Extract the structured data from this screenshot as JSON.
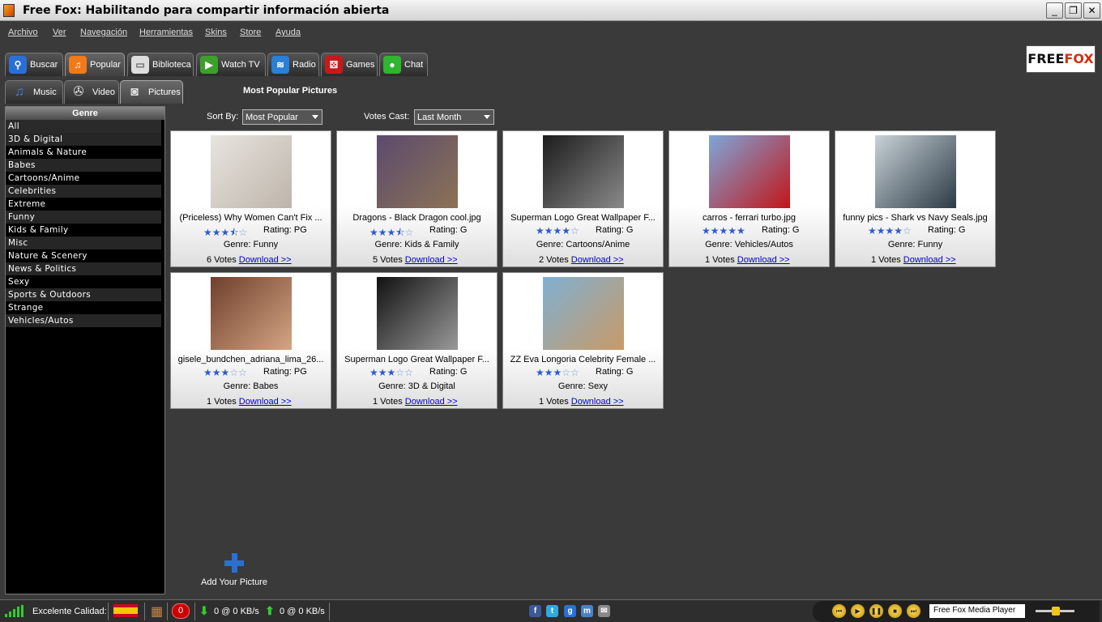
{
  "window": {
    "title": "Free Fox: Habilitando para compartir información abierta"
  },
  "menu": [
    "Archivo",
    "Ver",
    "Navegación",
    "Herramientas",
    "Skins",
    "Store",
    "Ayuda"
  ],
  "tabs": [
    {
      "label": "Buscar",
      "icon": "search-icon",
      "color": "#2a6fd6"
    },
    {
      "label": "Popular",
      "icon": "music-note-icon",
      "color": "#f07a1a"
    },
    {
      "label": "Biblioteca",
      "icon": "folder-icon",
      "color": "#dddddd"
    },
    {
      "label": "Watch TV",
      "icon": "play-icon",
      "color": "#3ca12a"
    },
    {
      "label": "Radio",
      "icon": "wifi-icon",
      "color": "#2a7fd6"
    },
    {
      "label": "Games",
      "icon": "dice-icon",
      "color": "#c8181b"
    },
    {
      "label": "Chat",
      "icon": "chat-bubble-icon",
      "color": "#2fb52f"
    }
  ],
  "logo": {
    "part1": "FREE",
    "part2": "FOX"
  },
  "subtabs": [
    {
      "label": "Music",
      "icon": "music-note-icon"
    },
    {
      "label": "Video",
      "icon": "film-reel-icon"
    },
    {
      "label": "Pictures",
      "icon": "camera-icon"
    }
  ],
  "section_title": "Most Popular Pictures",
  "sidebar": {
    "header": "Genre",
    "genres": [
      "All",
      "3D & Digital",
      "Animals & Nature",
      "Babes",
      "Cartoons/Anime",
      "Celebrities",
      "Extreme",
      "Funny",
      "Kids & Family",
      "Misc",
      "Nature & Scenery",
      "News & Politics",
      "Sexy",
      "Sports & Outdoors",
      "Strange",
      "Vehicles/Autos"
    ]
  },
  "controls": {
    "sort_label": "Sort By:",
    "sort_value": "Most Popular",
    "votes_label": "Votes Cast:",
    "votes_value": "Last Month"
  },
  "cards": [
    {
      "title": "(Priceless) Why Women Can't Fix ...",
      "stars": 3.5,
      "rating": "Rating: PG",
      "genre": "Genre: Funny",
      "votes": "6 Votes",
      "download": "Download >>",
      "thumb": [
        "#e8e4de",
        "#bdb5ab"
      ]
    },
    {
      "title": "Dragons - Black Dragon cool.jpg",
      "stars": 3.5,
      "rating": "Rating: G",
      "genre": "Genre: Kids & Family",
      "votes": "5 Votes",
      "download": "Download >>",
      "thumb": [
        "#5b4a6e",
        "#8c7355"
      ]
    },
    {
      "title": "Superman Logo Great Wallpaper F...",
      "stars": 4,
      "rating": "Rating: G",
      "genre": "Genre: Cartoons/Anime",
      "votes": "2 Votes",
      "download": "Download >>",
      "thumb": [
        "#1c1c1c",
        "#8a8a8a"
      ]
    },
    {
      "title": "carros - ferrari turbo.jpg",
      "stars": 5,
      "rating": "Rating: G",
      "genre": "Genre: Vehicles/Autos",
      "votes": "1 Votes",
      "download": "Download >>",
      "thumb": [
        "#7da6d9",
        "#c2161a"
      ]
    },
    {
      "title": "funny pics - Shark vs Navy Seals.jpg",
      "stars": 4,
      "rating": "Rating: G",
      "genre": "Genre: Funny",
      "votes": "1 Votes",
      "download": "Download >>",
      "thumb": [
        "#c9d2d8",
        "#2b3a45"
      ]
    },
    {
      "title": "gisele_bundchen_adriana_lima_26...",
      "stars": 3,
      "rating": "Rating: PG",
      "genre": "Genre: Babes",
      "votes": "1 Votes",
      "download": "Download >>",
      "thumb": [
        "#6e3f2b",
        "#d6a585"
      ]
    },
    {
      "title": "Superman Logo Great Wallpaper F...",
      "stars": 3,
      "rating": "Rating: G",
      "genre": "Genre: 3D & Digital",
      "votes": "1 Votes",
      "download": "Download >>",
      "thumb": [
        "#111111",
        "#9a9a9a"
      ]
    },
    {
      "title": "ZZ  Eva Longoria Celebrity Female ...",
      "stars": 3,
      "rating": "Rating: G",
      "genre": "Genre: Sexy",
      "votes": "1 Votes",
      "download": "Download >>",
      "thumb": [
        "#7fb0d2",
        "#c99a68"
      ]
    }
  ],
  "add_picture": "Add Your Picture",
  "status": {
    "quality": "Excelente Calidad:",
    "count": "0",
    "download_rate": "0 @ 0 KB/s",
    "upload_rate": "0 @ 0 KB/s",
    "social": [
      {
        "icon": "facebook-icon",
        "glyph": "f",
        "color": "#3b5998"
      },
      {
        "icon": "twitter-icon",
        "glyph": "t",
        "color": "#2fa9e0"
      },
      {
        "icon": "google-icon",
        "glyph": "g",
        "color": "#2a6fd6"
      },
      {
        "icon": "messenger-icon",
        "glyph": "m",
        "color": "#4a82c8"
      },
      {
        "icon": "email-icon",
        "glyph": "✉",
        "color": "#888888"
      }
    ],
    "player_name": "Free Fox Media Player"
  }
}
